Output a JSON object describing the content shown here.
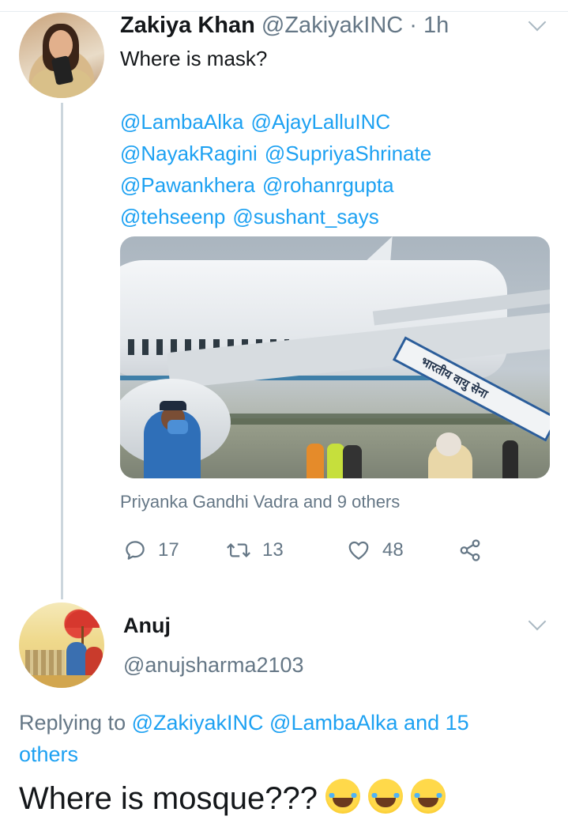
{
  "tweet1": {
    "name": "Zakiya Khan",
    "handle": "@ZakiyakINC",
    "dot": "·",
    "time": "1h",
    "text": "Where is mask?",
    "mentions": [
      "@LambaAlka",
      "@AjayLalluINC",
      "@NayakRagini",
      "@SupriyaShrinate",
      "@Pawankhera",
      "@rohanrgupta",
      "@tehseenp",
      "@sushant_says"
    ],
    "media": {
      "stairs_text": "भारतीय वायु सेना"
    },
    "liked_by": "Priyanka Gandhi Vadra and 9 others",
    "actions": {
      "reply_icon": "reply-icon",
      "reply_count": "17",
      "retweet_icon": "retweet-icon",
      "retweet_count": "13",
      "like_icon": "heart-icon",
      "like_count": "48",
      "share_icon": "share-icon"
    }
  },
  "tweet2": {
    "name": "Anuj",
    "handle": "@anujsharma2103",
    "replying_prefix": "Replying to",
    "replying_users": "@ZakiyakINC @LambaAlka",
    "replying_suffix": "and 15 others",
    "text": "Where is mosque???",
    "emoji_name": "face-with-tears-of-joy-icon"
  },
  "colors": {
    "link": "#1da1f2",
    "secondary_text": "#657786",
    "primary_text": "#14171a",
    "thread_line": "#ccd6dd"
  }
}
